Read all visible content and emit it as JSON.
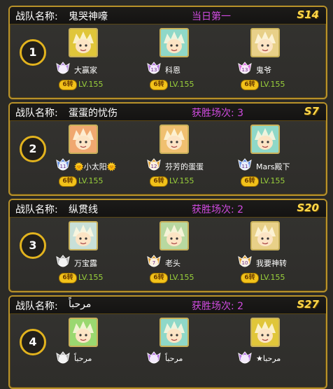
{
  "labels": {
    "team_label": "战队名称:"
  },
  "colors": {
    "accent_gold": "#e2b31e",
    "status_purple": "#d04be0",
    "level_green": "#9ad13b",
    "server_yellow": "#ffd84a"
  },
  "teams": [
    {
      "rank": "1",
      "name": "鬼哭神嚎",
      "status": "当日第一",
      "server": "S14",
      "members": [
        {
          "name": "大赢家",
          "rebirth": "6转",
          "level": "LV.155",
          "vip": "",
          "badge_color": "#b58be0",
          "portrait": "blond",
          "avatar_bg": "#e0c63a"
        },
        {
          "name": "科恩",
          "rebirth": "6转",
          "level": "LV.155",
          "vip": "13",
          "badge_color": "#b070e0",
          "portrait": "teal",
          "avatar_bg": "#8fd8c8"
        },
        {
          "name": "鬼爷",
          "rebirth": "6转",
          "level": "LV.155",
          "vip": "13",
          "badge_color": "#d96adf",
          "portrait": "sheep",
          "avatar_bg": "#e8d088"
        }
      ]
    },
    {
      "rank": "2",
      "name": "蛋蛋的忧伤",
      "status": "获胜场次: 3",
      "server": "S7",
      "members": [
        {
          "name": "🌞小太阳🌞",
          "rebirth": "6转",
          "level": "LV.155",
          "vip": "11",
          "badge_color": "#5f8be0",
          "portrait": "orange",
          "avatar_bg": "#f0a870"
        },
        {
          "name": "芬芳的蛋蛋",
          "rebirth": "6转",
          "level": "LV.155",
          "vip": "12",
          "badge_color": "#e0a030",
          "portrait": "cat",
          "avatar_bg": "#f0c070"
        },
        {
          "name": "Mars殿下",
          "rebirth": "6转",
          "level": "LV.155",
          "vip": "11",
          "badge_color": "#5f8be0",
          "portrait": "teal",
          "avatar_bg": "#8fd8c8"
        }
      ]
    },
    {
      "rank": "3",
      "name": "纵贯线",
      "status": "获胜场次: 2",
      "server": "S20",
      "members": [
        {
          "name": "万宝露",
          "rebirth": "6转",
          "level": "LV.155",
          "vip": "",
          "badge_color": "#b0b0b0",
          "portrait": "white",
          "avatar_bg": "#c8e0d8"
        },
        {
          "name": "老头",
          "rebirth": "6转",
          "level": "LV.155",
          "vip": "7",
          "badge_color": "#e0a030",
          "portrait": "old",
          "avatar_bg": "#b8d8a0"
        },
        {
          "name": "我要神转",
          "rebirth": "6转",
          "level": "LV.155",
          "vip": "10",
          "badge_color": "#e0a030",
          "portrait": "sheep",
          "avatar_bg": "#e8d088"
        }
      ]
    },
    {
      "rank": "4",
      "name": "مرحباً",
      "status": "获胜场次: 2",
      "server": "S27",
      "members": [
        {
          "name": "مرحباً",
          "rebirth": "",
          "level": "",
          "vip": "",
          "badge_color": "#b0b0b0",
          "portrait": "green",
          "avatar_bg": "#9ad870"
        },
        {
          "name": "مرحباً",
          "rebirth": "",
          "level": "",
          "vip": "",
          "badge_color": "#b070e0",
          "portrait": "teal",
          "avatar_bg": "#8fd8c8"
        },
        {
          "name": "★مرحبا",
          "rebirth": "",
          "level": "",
          "vip": "",
          "badge_color": "#b070e0",
          "portrait": "blond",
          "avatar_bg": "#e0c63a"
        }
      ]
    }
  ]
}
